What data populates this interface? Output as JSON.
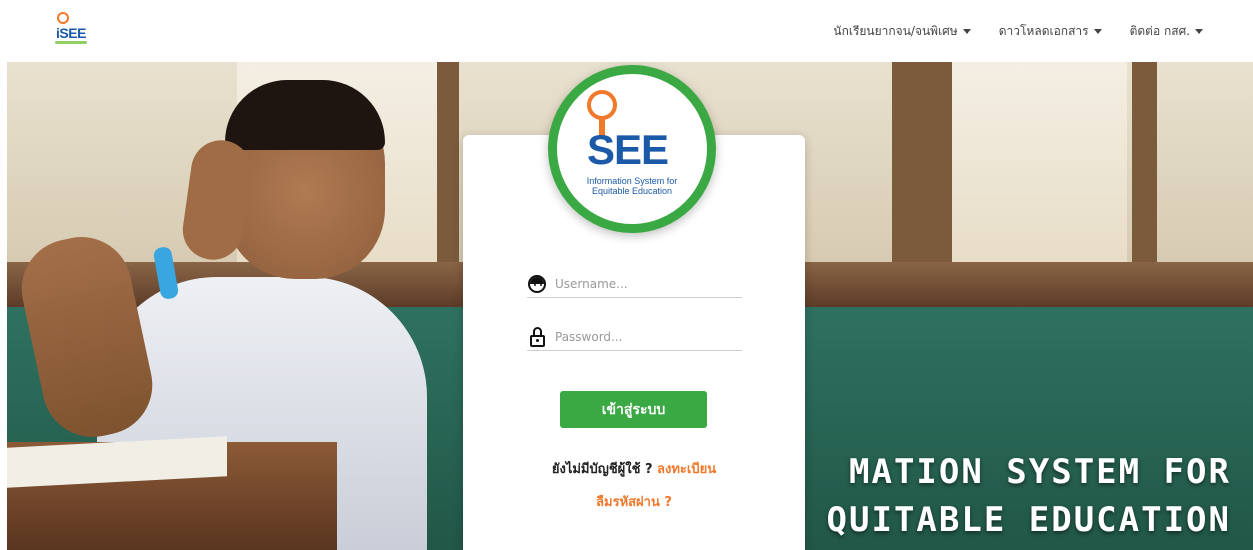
{
  "brand": {
    "logo_text": "iSEE"
  },
  "nav": {
    "items": [
      {
        "label": "นักเรียนยากจน/จนพิเศษ"
      },
      {
        "label": "ดาวโหลดเอกสาร"
      },
      {
        "label": "ติดต่อ กสศ."
      }
    ]
  },
  "hero": {
    "line1": "MATION SYSTEM FOR",
    "line2": "QUITABLE EDUCATION"
  },
  "logo": {
    "word": "SEE",
    "tagline_1": "Information System for",
    "tagline_2": "Equitable Education"
  },
  "login": {
    "username_placeholder": "Username...",
    "password_placeholder": "Password...",
    "submit_label": "เข้าสู่ระบบ",
    "register_prompt": "ยังไม่มีบัญชีผู้ใช้ ?",
    "register_link": "ลงทะเบียน",
    "forgot_link": "ลืมรหัสผ่าน ?"
  },
  "colors": {
    "accent": "#3aa843",
    "link": "#f0792b",
    "brand_blue": "#1b5aa8"
  },
  "icons": {
    "username": "user-face-icon",
    "password": "lock-icon",
    "dropdown": "caret-down-icon"
  }
}
